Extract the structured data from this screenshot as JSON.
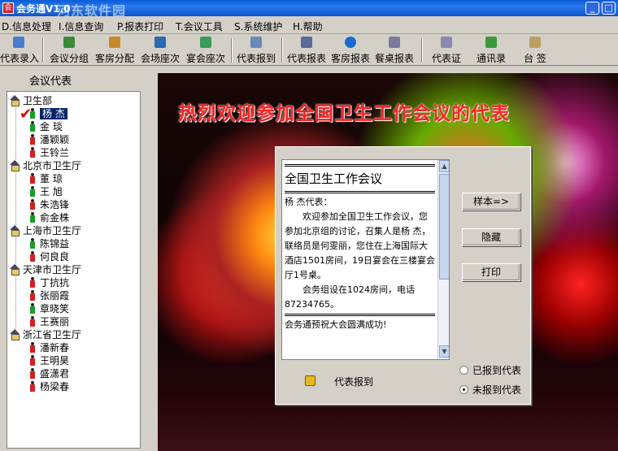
{
  "window": {
    "title": "会务通V1.0",
    "watermark": "河东软件园"
  },
  "menu": [
    {
      "label": "D.信息处理"
    },
    {
      "label": "I.信息查询"
    },
    {
      "label": "P.报表打印"
    },
    {
      "label": "T.会议工具"
    },
    {
      "label": "S.系统维护"
    },
    {
      "label": "H.帮助"
    }
  ],
  "toolbar": [
    {
      "label": "代表录入",
      "icon": "person-icon"
    },
    {
      "label": "会议分组",
      "icon": "group-icon"
    },
    {
      "label": "客房分配",
      "icon": "room-icon"
    },
    {
      "label": "会场座次",
      "icon": "seat-icon"
    },
    {
      "label": "宴会座次",
      "icon": "banquet-icon"
    },
    {
      "label": "代表报到",
      "icon": "checkin-icon"
    },
    {
      "label": "代表报表",
      "icon": "report-icon"
    },
    {
      "label": "客房报表",
      "icon": "refresh-icon"
    },
    {
      "label": "餐桌报表",
      "icon": "table-icon"
    },
    {
      "label": "代表证",
      "icon": "badge-icon"
    },
    {
      "label": "通讯录",
      "icon": "book-icon"
    },
    {
      "label": "台 签",
      "icon": "card-icon"
    }
  ],
  "watermark_url": "www.pc0359.cn",
  "sidebar": {
    "title": "会议代表",
    "groups": [
      {
        "name": "卫生部",
        "members": [
          {
            "name": "杨  杰",
            "g": "m"
          },
          {
            "name": "金  琰",
            "g": "m"
          },
          {
            "name": "潘颖颖",
            "g": "f"
          },
          {
            "name": "王铃兰",
            "g": "f"
          }
        ]
      },
      {
        "name": "北京市卫生厅",
        "members": [
          {
            "name": "董  琼",
            "g": "f"
          },
          {
            "name": "王  旭",
            "g": "m"
          },
          {
            "name": "朱浩锋",
            "g": "f"
          },
          {
            "name": "俞金株",
            "g": "m"
          }
        ]
      },
      {
        "name": "上海市卫生厅",
        "members": [
          {
            "name": "陈锦益",
            "g": "m"
          },
          {
            "name": "何良良",
            "g": "f"
          }
        ]
      },
      {
        "name": "天津市卫生厅",
        "members": [
          {
            "name": "丁抗抗",
            "g": "f"
          },
          {
            "name": "张丽霞",
            "g": "f"
          },
          {
            "name": "章晓笑",
            "g": "m"
          },
          {
            "name": "王赛丽",
            "g": "f"
          }
        ]
      },
      {
        "name": "浙江省卫生厅",
        "members": [
          {
            "name": "潘新春",
            "g": "f"
          },
          {
            "name": "王明昊",
            "g": "f"
          },
          {
            "name": "盛潇君",
            "g": "f"
          },
          {
            "name": "杨梁春",
            "g": "f"
          }
        ]
      }
    ]
  },
  "banner": "热烈欢迎参加全国卫生工作会议的代表",
  "letter": {
    "title": "全国卫生工作会议",
    "greeting": "杨  杰代表：",
    "body": "欢迎参加全国卫生工作会议，您参加北京组的讨论，召集人是杨  杰，联络员是何雯丽，您住在上海国际大酒店1501房间，19日宴会在三楼宴会厅1号桌。",
    "body2": "会务组设在1024房间，电话87234765。",
    "closing": "会务通预祝大会圆满成功!"
  },
  "buttons": {
    "sample": "样本=>",
    "hide": "隐藏",
    "print": "打印"
  },
  "report_label": "代表报到",
  "radios": {
    "reported": "已报到代表",
    "unreported": "未报到代表"
  }
}
